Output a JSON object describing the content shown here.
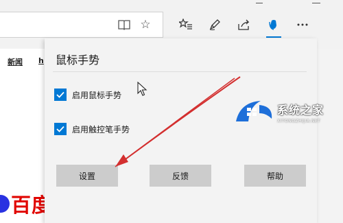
{
  "page": {
    "nav_links": [
      "新闻",
      "h"
    ],
    "brand_text": "百度"
  },
  "panel": {
    "title": "鼠标手势",
    "options": [
      {
        "label": "启用鼠标手势",
        "checked": true
      },
      {
        "label": "启用触控笔手势",
        "checked": true
      }
    ],
    "buttons": {
      "settings": "设置",
      "feedback": "反馈",
      "help": "帮助"
    }
  },
  "toolbar": {
    "icons": [
      "reading-view-icon",
      "favorite-star-icon",
      "favorites-hub-icon",
      "pen-icon",
      "share-icon",
      "mouse-gesture-extension-icon",
      "more-icon"
    ]
  },
  "watermark": {
    "main": "系统之家",
    "sub": "XITONGZHIJIA.NET"
  },
  "colors": {
    "accent": "#0078d4",
    "panel_bg": "#f3f3f3",
    "button_bg": "#cccccc",
    "arrow": "#d32f2f",
    "brand_red": "#e10602",
    "brand_blue": "#2932e1"
  }
}
